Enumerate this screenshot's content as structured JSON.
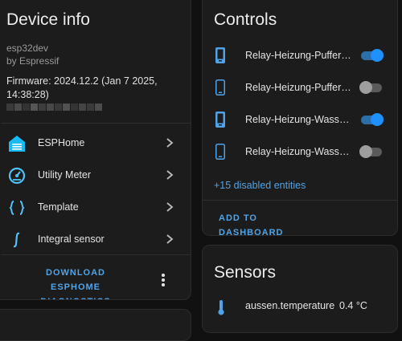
{
  "device_card": {
    "title": "Device info",
    "model": "esp32dev",
    "manufacturer": "by Espressif",
    "firmware": "Firmware: 2024.12.2 (Jan 7 2025, 14:38:28)",
    "integrations": [
      {
        "label": "ESPHome",
        "icon": "esphome-house-icon"
      },
      {
        "label": "Utility Meter",
        "icon": "gauge-icon"
      },
      {
        "label": "Template",
        "icon": "braces-icon"
      },
      {
        "label": "Integral sensor",
        "icon": "integral-icon"
      }
    ],
    "download_label": "DOWNLOAD ESPHOME DIAGNOSTICS"
  },
  "controls_card": {
    "title": "Controls",
    "items": [
      {
        "label": "Relay-Heizung-Puffer-f…",
        "state": "on"
      },
      {
        "label": "Relay-Heizung-Puffer-k…",
        "state": "off"
      },
      {
        "label": "Relay-Heizung-Wasser-…",
        "state": "on"
      },
      {
        "label": "Relay-Heizung-Wasser-…",
        "state": "off"
      }
    ],
    "disabled_link": "+15 disabled entities",
    "add_button": "ADD TO DASHBOARD"
  },
  "sensors_card": {
    "title": "Sensors",
    "items": [
      {
        "label": "aussen.temperature",
        "value": "0.4 °C",
        "icon": "thermometer-icon"
      }
    ]
  },
  "colors": {
    "accent": "#4fa3e8",
    "toggle_on": "#1e90ff",
    "background": "#111111",
    "card": "#1c1c1c"
  }
}
